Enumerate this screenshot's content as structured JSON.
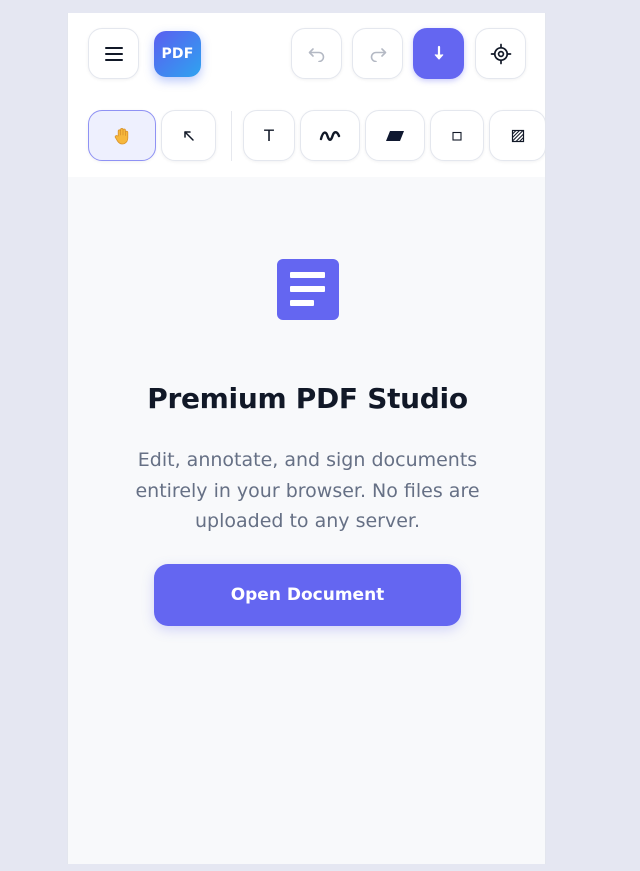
{
  "header": {
    "menu_icon": "hamburger-menu-icon",
    "logo_text": "PDF",
    "undo_icon": "undo-icon",
    "redo_icon": "redo-icon",
    "download_icon": "download-arrow-icon",
    "settings_icon": "gear-icon"
  },
  "toolbar": {
    "tools": [
      {
        "id": "pan",
        "icon": "hand-icon",
        "active": true
      },
      {
        "id": "select",
        "icon": "cursor-arrow-icon",
        "active": false
      },
      {
        "id": "text",
        "label": "T",
        "icon": "text-icon",
        "active": false
      },
      {
        "id": "draw",
        "icon": "freehand-draw-icon",
        "active": false
      },
      {
        "id": "highlight",
        "icon": "highlight-icon",
        "active": false
      },
      {
        "id": "rectangle",
        "icon": "rectangle-icon",
        "active": false
      },
      {
        "id": "redact",
        "icon": "redact-hatch-icon",
        "active": false
      }
    ]
  },
  "empty_state": {
    "icon": "document-lines-icon",
    "title": "Premium PDF Studio",
    "description": "Edit, annotate, and sign documents entirely in your browser. No files are uploaded to any server.",
    "cta_label": "Open Document"
  },
  "colors": {
    "accent": "#6466f1",
    "logo_gradient_start": "#5b5ef0",
    "logo_gradient_end": "#2ea3f0",
    "title_text": "#111827",
    "muted_text": "#667085",
    "page_background": "#e5e7f2",
    "app_background": "#f8f9fb"
  }
}
